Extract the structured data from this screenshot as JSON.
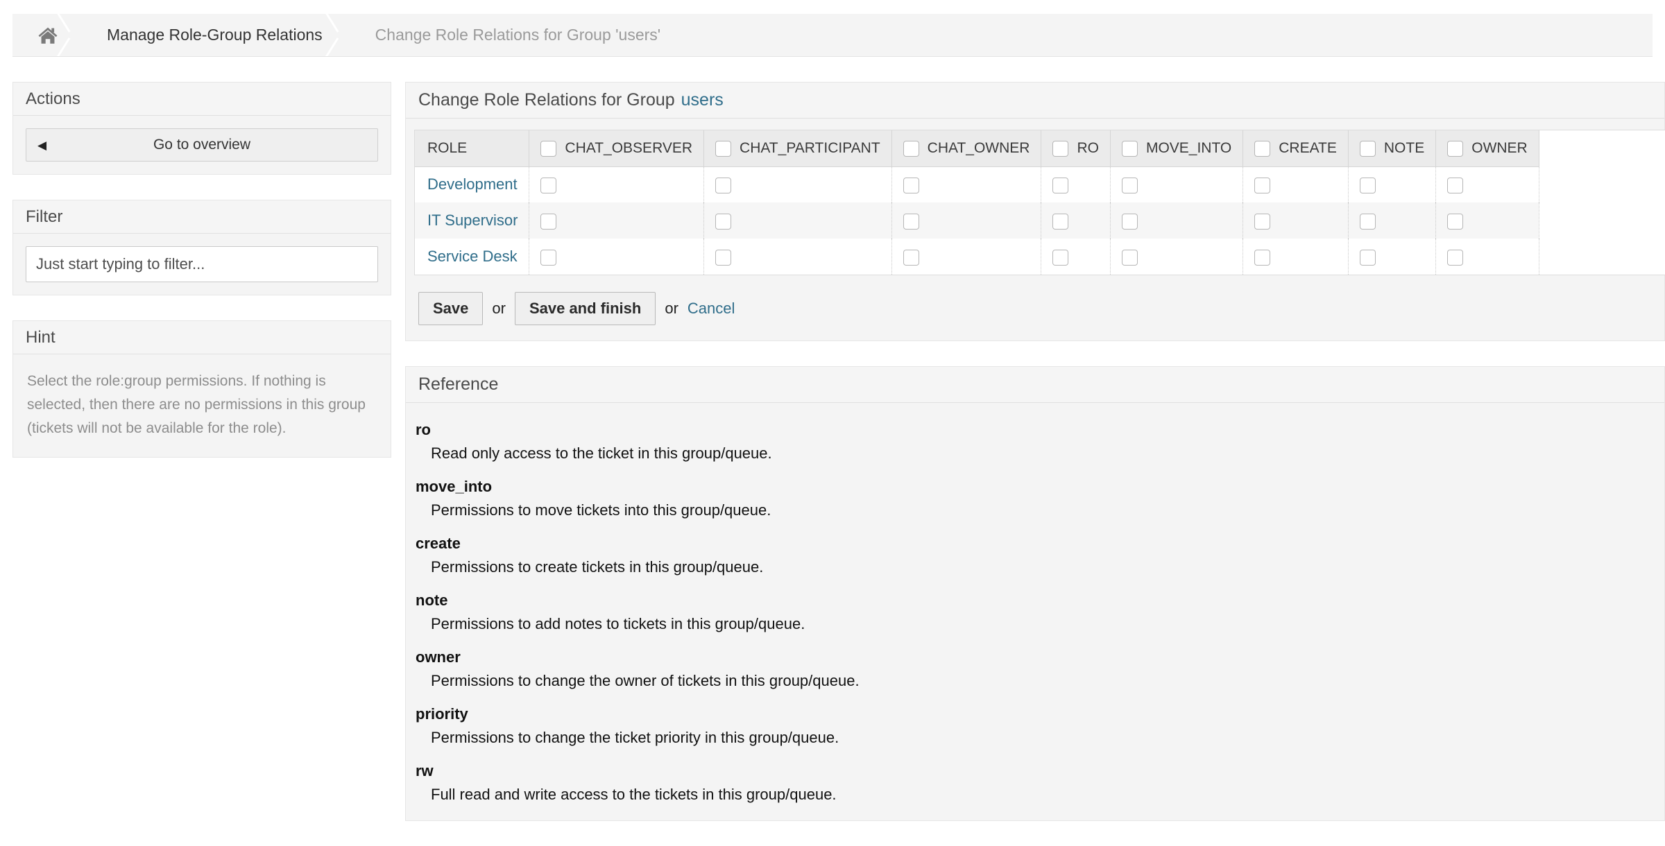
{
  "breadcrumb": {
    "home_icon": "home-icon",
    "items": [
      {
        "label": "Manage Role-Group Relations",
        "muted": false
      },
      {
        "label": "Change Role Relations for Group 'users'",
        "muted": true
      }
    ]
  },
  "sidebar": {
    "actions": {
      "title": "Actions",
      "overview_button": {
        "label": "Go to overview",
        "caret": "◀"
      }
    },
    "filter": {
      "title": "Filter",
      "input_value": "",
      "placeholder": "Just start typing to filter..."
    },
    "hint": {
      "title": "Hint",
      "text": "Select the role:group permissions. If nothing is selected, then there are no permissions in this group (tickets will not be available for the role)."
    }
  },
  "main": {
    "panel": {
      "title": "Change Role Relations for Group",
      "group_name": "users",
      "group_link_color": "#2f6d8a"
    },
    "table": {
      "role_column_header": "ROLE",
      "permission_columns": [
        "CHAT_OBSERVER",
        "CHAT_PARTICIPANT",
        "CHAT_OWNER",
        "RO",
        "MOVE_INTO",
        "CREATE",
        "NOTE",
        "OWNER"
      ],
      "rows": [
        {
          "role": "Development",
          "checked": [
            false,
            false,
            false,
            false,
            false,
            false,
            false,
            false
          ]
        },
        {
          "role": "IT Supervisor",
          "checked": [
            false,
            false,
            false,
            false,
            false,
            false,
            false,
            false
          ]
        },
        {
          "role": "Service Desk",
          "checked": [
            false,
            false,
            false,
            false,
            false,
            false,
            false,
            false
          ]
        }
      ]
    },
    "form_actions": {
      "save_label": "Save",
      "or_1": "or",
      "save_and_finish_label": "Save and finish",
      "or_2": "or",
      "cancel_label": "Cancel"
    }
  },
  "reference": {
    "title": "Reference",
    "entries": [
      {
        "term": "ro",
        "description": "Read only access to the ticket in this group/queue."
      },
      {
        "term": "move_into",
        "description": "Permissions to move tickets into this group/queue."
      },
      {
        "term": "create",
        "description": "Permissions to create tickets in this group/queue."
      },
      {
        "term": "note",
        "description": "Permissions to add notes to tickets in this group/queue."
      },
      {
        "term": "owner",
        "description": "Permissions to change the owner of tickets in this group/queue."
      },
      {
        "term": "priority",
        "description": "Permissions to change the ticket priority in this group/queue."
      },
      {
        "term": "rw",
        "description": "Full read and write access to the tickets in this group/queue."
      }
    ]
  }
}
